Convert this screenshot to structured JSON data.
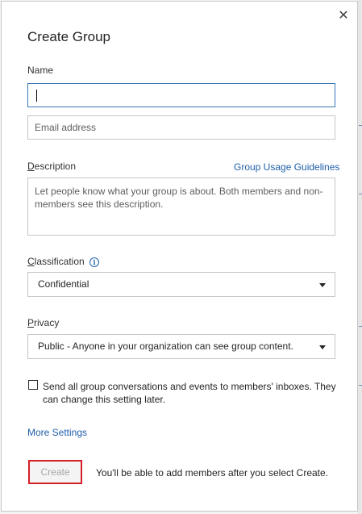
{
  "dialog": {
    "title": "Create Group",
    "close_icon": "close-icon"
  },
  "form": {
    "name_label": "Name",
    "name_value": "",
    "email_placeholder": "Email address",
    "description_label_rest": "escription",
    "description_label_first": "D",
    "usage_link": "Group Usage Guidelines",
    "description_placeholder": "Let people know what your group is about. Both members and non-members see this description.",
    "classification_label_first": "C",
    "classification_label_rest": "lassification",
    "classification_value": "Confidential",
    "privacy_label_first": "P",
    "privacy_label_rest": "rivacy",
    "privacy_value": "Public - Anyone in your organization can see group content.",
    "checkbox_label": "Send all group conversations and events to members' inboxes. They can change this setting later.",
    "checkbox_checked": false,
    "more_settings": "More Settings",
    "create_button": "Create",
    "create_hint": "You'll be able to add members after you select Create."
  },
  "colors": {
    "link": "#1f5fa8",
    "highlight_border": "#d42027",
    "focus_border": "#3a77b8"
  }
}
